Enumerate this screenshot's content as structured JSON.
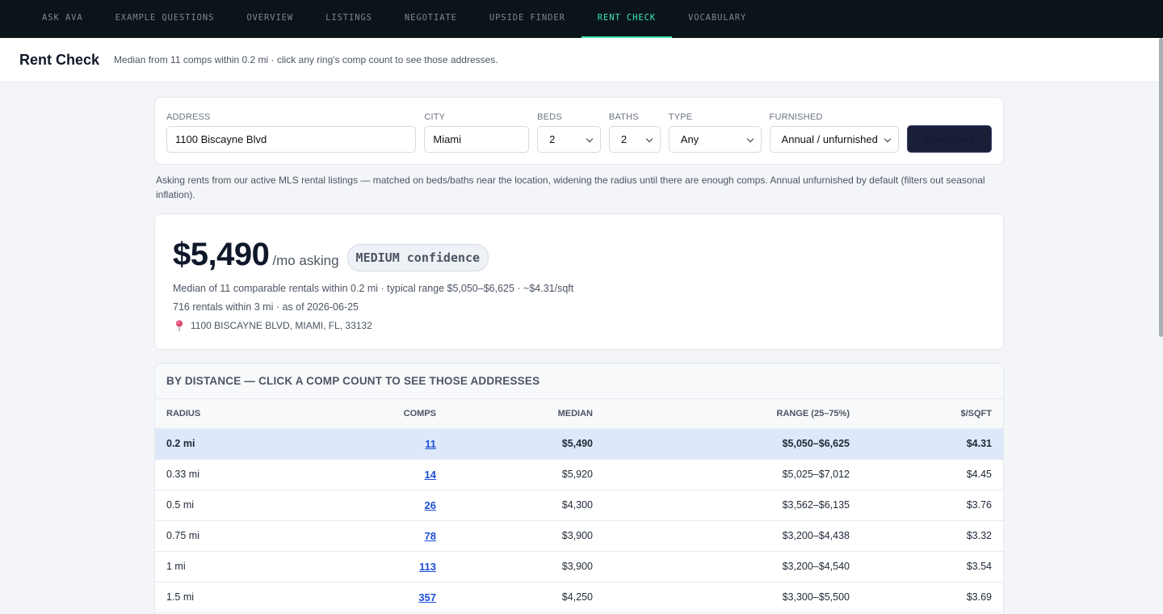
{
  "nav": {
    "tabs": [
      {
        "label": "ASK AVA"
      },
      {
        "label": "EXAMPLE QUESTIONS"
      },
      {
        "label": "OVERVIEW"
      },
      {
        "label": "LISTINGS"
      },
      {
        "label": "NEGOTIATE"
      },
      {
        "label": "UPSIDE FINDER"
      },
      {
        "label": "RENT CHECK"
      },
      {
        "label": "VOCABULARY"
      }
    ],
    "active_tab": "RENT CHECK"
  },
  "header": {
    "title": "Rent Check",
    "subtitle": "Median from 11 comps within 0.2 mi · click any ring's comp count to see those addresses."
  },
  "form": {
    "address_label": "ADDRESS",
    "address_value": "1100 Biscayne Blvd",
    "city_label": "CITY",
    "city_value": "Miami",
    "beds_label": "BEDS",
    "beds_value": "2",
    "baths_label": "BATHS",
    "baths_value": "2",
    "type_label": "TYPE",
    "type_value": "Any",
    "furnished_label": "FURNISHED",
    "furnished_value": "Annual / unfurnished",
    "submit_label": "Check rent"
  },
  "note": "Asking rents from our active MLS rental listings — matched on beds/baths near the location, widening the radius until there are enough comps. Annual unfurnished by default (filters out seasonal inflation).",
  "result": {
    "price": "$5,490",
    "per": "/mo asking",
    "confidence": "MEDIUM confidence",
    "summary": "Median of 11 comparable rentals within 0.2 mi · typical range $5,050–$6,625 · ~$4.31/sqft",
    "inventory": "716 rentals within 3 mi · as of 2026-06-25",
    "location": "1100 BISCAYNE BLVD, MIAMI, FL, 33132",
    "pin_color": "#e0436b"
  },
  "table": {
    "title": "BY DISTANCE — CLICK A COMP COUNT TO SEE THOSE ADDRESSES",
    "headers": [
      "RADIUS",
      "COMPS",
      "MEDIAN",
      "RANGE (25–75%)",
      "$/SQFT"
    ],
    "rows": [
      {
        "radius": "0.2 mi",
        "comps": "11",
        "median": "$5,490",
        "range": "$5,050–$6,625",
        "psf": "$4.31",
        "highlight": true
      },
      {
        "radius": "0.33 mi",
        "comps": "14",
        "median": "$5,920",
        "range": "$5,025–$7,012",
        "psf": "$4.45",
        "highlight": false
      },
      {
        "radius": "0.5 mi",
        "comps": "26",
        "median": "$4,300",
        "range": "$3,562–$6,135",
        "psf": "$3.76",
        "highlight": false
      },
      {
        "radius": "0.75 mi",
        "comps": "78",
        "median": "$3,900",
        "range": "$3,200–$4,438",
        "psf": "$3.32",
        "highlight": false
      },
      {
        "radius": "1 mi",
        "comps": "113",
        "median": "$3,900",
        "range": "$3,200–$4,540",
        "psf": "$3.54",
        "highlight": false
      },
      {
        "radius": "1.5 mi",
        "comps": "357",
        "median": "$4,250",
        "range": "$3,300–$5,500",
        "psf": "$3.69",
        "highlight": false
      }
    ]
  },
  "colors": {
    "nav_bg": "#0b1418",
    "accent": "#3ee6b6",
    "link": "#1d4ed8",
    "highlight_row": "#dde9fb",
    "button_bg": "#1a1f38"
  }
}
